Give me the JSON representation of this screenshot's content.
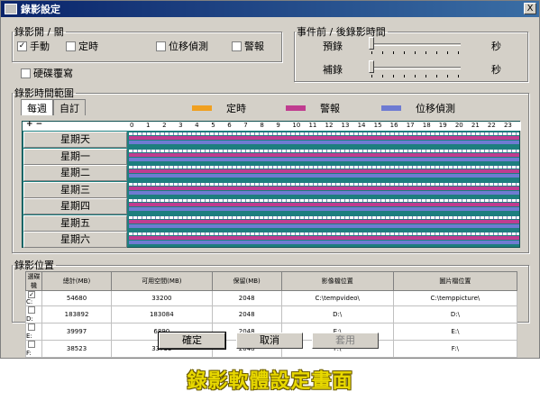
{
  "window": {
    "title": "錄影設定",
    "close_label": "X"
  },
  "record_toggle": {
    "legend": "錄影開 / 關",
    "options": [
      {
        "label": "手動",
        "checked": true
      },
      {
        "label": "定時",
        "checked": false
      },
      {
        "label": "位移偵測",
        "checked": false
      },
      {
        "label": "警報",
        "checked": false
      }
    ],
    "overwrite": {
      "label": "硬碟覆寫",
      "checked": false
    }
  },
  "pre_post": {
    "legend": "事件前 / 後錄影時間",
    "pre_label": "預錄",
    "post_label": "補錄",
    "unit": "秒"
  },
  "schedule": {
    "legend": "錄影時間範圍",
    "tabs": [
      "每週",
      "自訂"
    ],
    "legend_items": [
      {
        "label": "定時",
        "color": "#f0a020"
      },
      {
        "label": "警報",
        "color": "#c03c90"
      },
      {
        "label": "位移偵測",
        "color": "#6e7bd2"
      }
    ],
    "plus_minus": "+ −",
    "hours": [
      "0",
      "1",
      "2",
      "3",
      "4",
      "5",
      "6",
      "7",
      "8",
      "9",
      "10",
      "11",
      "12",
      "13",
      "14",
      "15",
      "16",
      "17",
      "18",
      "19",
      "20",
      "21",
      "22",
      "23"
    ],
    "days": [
      "星期天",
      "星期一",
      "星期二",
      "星期三",
      "星期四",
      "星期五",
      "星期六"
    ]
  },
  "storage": {
    "legend": "錄影位置",
    "headers": [
      "選碟機",
      "總計(MB)",
      "可用空間(MB)",
      "保留(MB)",
      "影像檔位置",
      "圖片檔位置"
    ],
    "rows": [
      {
        "checked": true,
        "drive": "C:",
        "total": "54680",
        "free": "33200",
        "reserve": "2048",
        "video": "C:\\tempvideo\\",
        "picture": "C:\\temppicture\\"
      },
      {
        "checked": false,
        "drive": "D:",
        "total": "183892",
        "free": "183084",
        "reserve": "2048",
        "video": "D:\\",
        "picture": "D:\\"
      },
      {
        "checked": false,
        "drive": "E:",
        "total": "39997",
        "free": "6890",
        "reserve": "2048",
        "video": "E:\\",
        "picture": "E:\\"
      },
      {
        "checked": false,
        "drive": "F:",
        "total": "38523",
        "free": "33733",
        "reserve": "2048",
        "video": "F:\\",
        "picture": "F:\\"
      }
    ]
  },
  "buttons": {
    "ok": "確定",
    "cancel": "取消",
    "apply": "套用"
  },
  "caption": "錄影軟體設定畫面"
}
